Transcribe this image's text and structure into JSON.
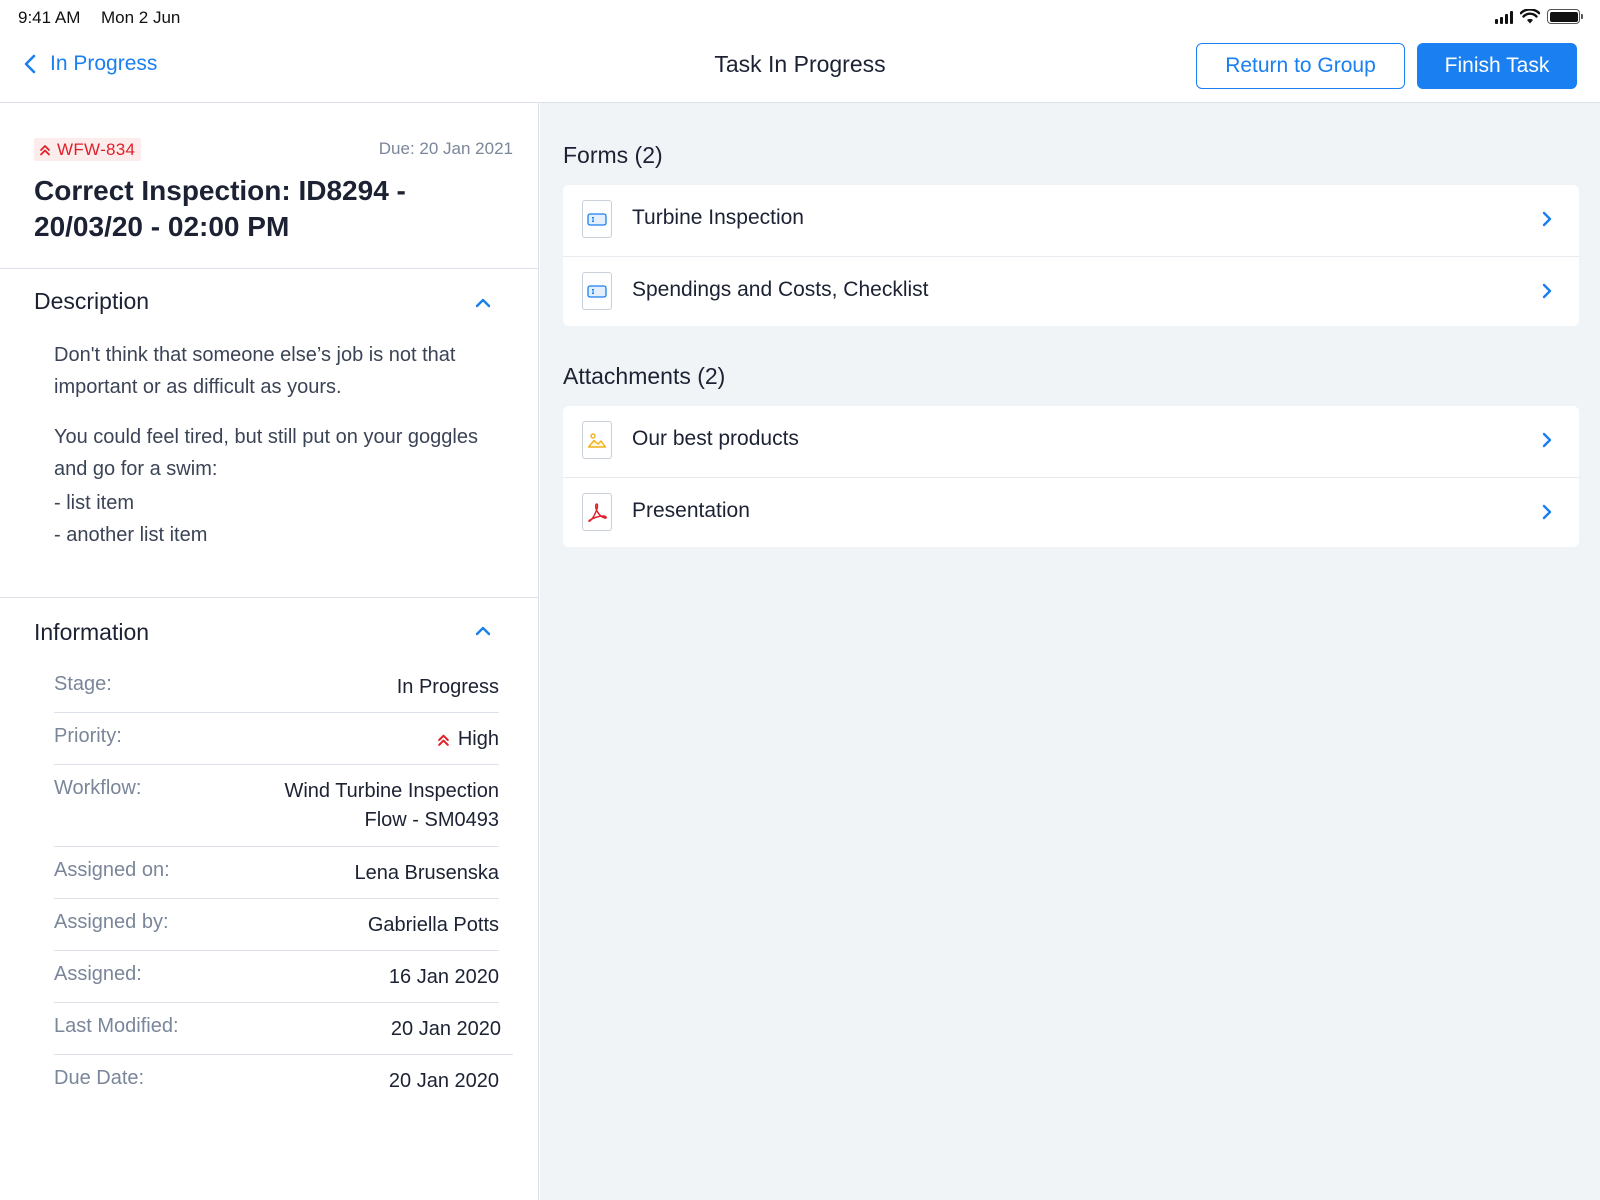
{
  "status_bar": {
    "time": "9:41 AM",
    "date": "Mon 2 Jun"
  },
  "nav": {
    "back_label": "In Progress",
    "title": "Task In Progress",
    "return_button": "Return to Group",
    "finish_button": "Finish Task"
  },
  "task": {
    "id": "WFW-834",
    "due": "Due: 20 Jan 2021",
    "title": "Correct Inspection: ID8294 - 20/03/20 - 02:00 PM"
  },
  "description": {
    "heading": "Description",
    "para1": "Don't think that someone else’s job is not that important or as difficult as yours.",
    "para2": "You could feel tired, but still put on your goggles and go for a swim:",
    "list": [
      "- list item",
      "- another list item"
    ]
  },
  "information": {
    "heading": "Information",
    "rows": [
      {
        "label": "Stage:",
        "value": "In Progress"
      },
      {
        "label": "Priority:",
        "value": "High"
      },
      {
        "label": "Workflow:",
        "value": "Wind Turbine Inspection",
        "value2": "Flow -  SM0493"
      },
      {
        "label": "Assigned on:",
        "value": "Lena Brusenska"
      },
      {
        "label": "Assigned by:",
        "value": "Gabriella Potts"
      },
      {
        "label": "Assigned:",
        "value": "16 Jan 2020"
      },
      {
        "label": "Last Modified:",
        "value": "20 Jan 2020"
      },
      {
        "label": "Due Date:",
        "value": "20 Jan 2020"
      }
    ]
  },
  "forms": {
    "heading": "Forms (2)",
    "items": [
      {
        "label": "Turbine Inspection",
        "icon": "form-icon"
      },
      {
        "label": "Spendings and Costs, Checklist",
        "icon": "form-icon"
      }
    ]
  },
  "attachments": {
    "heading": "Attachments (2)",
    "items": [
      {
        "label": "Our best products",
        "icon": "image-file-icon"
      },
      {
        "label": "Presentation",
        "icon": "pdf-file-icon"
      }
    ]
  },
  "colors": {
    "accent": "#1a7ff0",
    "priority_high": "#e0202a",
    "panel_bg": "#f1f4f7",
    "divider": "#dde2ea"
  }
}
